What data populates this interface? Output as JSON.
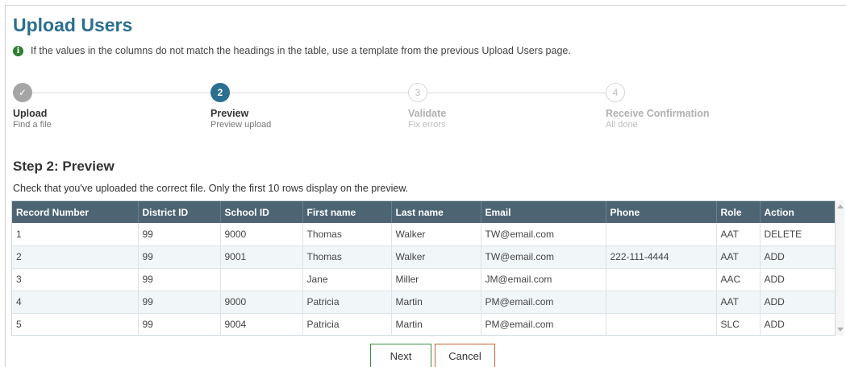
{
  "page": {
    "title": "Upload Users"
  },
  "info": {
    "icon": "info-icon",
    "text": "If the values in the columns do not match the headings in the table, use a template from the previous Upload Users page."
  },
  "stepper": {
    "steps": [
      {
        "number": "✓",
        "title": "Upload",
        "subtitle": "Find a file",
        "state": "done"
      },
      {
        "number": "2",
        "title": "Preview",
        "subtitle": "Preview upload",
        "state": "active"
      },
      {
        "number": "3",
        "title": "Validate",
        "subtitle": "Fix errors",
        "state": "pending"
      },
      {
        "number": "4",
        "title": "Receive Confirmation",
        "subtitle": "All done",
        "state": "pending"
      }
    ]
  },
  "section": {
    "title": "Step 2: Preview",
    "instruction": "Check that you've uploaded the correct file. Only the first 10 rows display on the preview."
  },
  "table": {
    "headers": [
      "Record Number",
      "District ID",
      "School ID",
      "First name",
      "Last name",
      "Email",
      "Phone",
      "Role",
      "Action"
    ],
    "rows": [
      [
        "1",
        "99",
        "9000",
        "Thomas",
        "Walker",
        "TW@email.com",
        "",
        "AAT",
        "DELETE"
      ],
      [
        "2",
        "99",
        "9001",
        "Thomas",
        "Walker",
        "TW@email.com",
        "222-111-4444",
        "AAT",
        "ADD"
      ],
      [
        "3",
        "99",
        "",
        "Jane",
        "Miller",
        "JM@email.com",
        "",
        "AAC",
        "ADD"
      ],
      [
        "4",
        "99",
        "9000",
        "Patricia",
        "Martin",
        "PM@email.com",
        "",
        "AAT",
        "ADD"
      ],
      [
        "5",
        "99",
        "9004",
        "Patricia",
        "Martin",
        "PM@email.com",
        "",
        "SLC",
        "ADD"
      ]
    ]
  },
  "buttons": {
    "next": "Next",
    "cancel": "Cancel"
  },
  "colors": {
    "title": "#2a6f8f",
    "header_bg": "#4d6573",
    "active_step": "#2b6f91",
    "next_border": "#3a8d3e",
    "cancel_border": "#c9622f"
  }
}
